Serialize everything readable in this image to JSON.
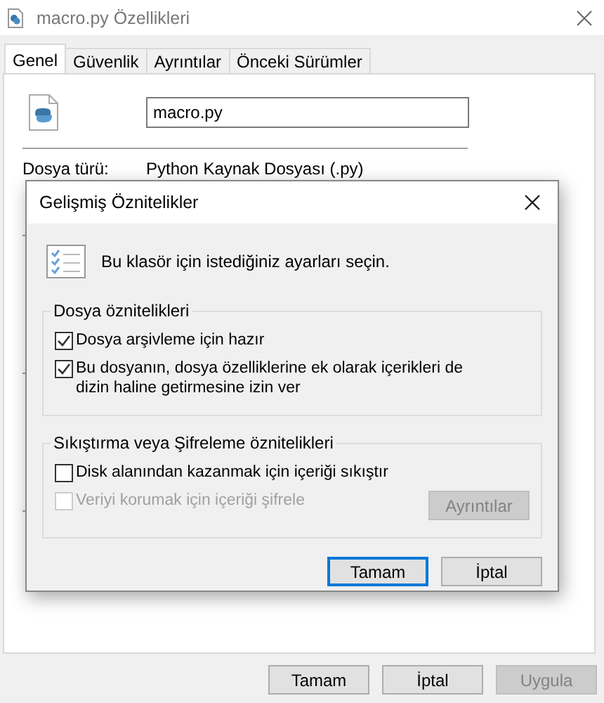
{
  "window": {
    "title": "macro.py Özellikleri"
  },
  "tabs": [
    {
      "label": "Genel",
      "selected": true
    },
    {
      "label": "Güvenlik",
      "selected": false
    },
    {
      "label": "Ayrıntılar",
      "selected": false
    },
    {
      "label": "Önceki Sürümler",
      "selected": false
    }
  ],
  "general": {
    "file_name": "macro.py",
    "type_label": "Dosya türü:",
    "type_value": "Python Kaynak Dosyası (.py)"
  },
  "dialog": {
    "title": "Gelişmiş Öznitelikler",
    "intro": "Bu klasör için istediğiniz ayarları seçin.",
    "groups": [
      {
        "title": "Dosya öznitelikleri",
        "options": [
          {
            "label": "Dosya arşivleme için hazır",
            "checked": true,
            "disabled": false
          },
          {
            "label": "Bu dosyanın, dosya özelliklerine ek olarak içerikleri de dizin haline getirmesine izin ver",
            "checked": true,
            "disabled": false
          }
        ]
      },
      {
        "title": "Sıkıştırma veya Şifreleme öznitelikleri",
        "options": [
          {
            "label": "Disk alanından kazanmak için içeriği sıkıştır",
            "checked": false,
            "disabled": false
          },
          {
            "label": "Veriyi korumak için içeriği şifrele",
            "checked": false,
            "disabled": true,
            "button": {
              "label": "Ayrıntılar",
              "disabled": true
            }
          }
        ]
      }
    ],
    "buttons": [
      {
        "label": "Tamam",
        "default": true
      },
      {
        "label": "İptal",
        "default": false
      }
    ]
  },
  "buttons": [
    {
      "label": "Tamam",
      "disabled": false
    },
    {
      "label": "İptal",
      "disabled": false
    },
    {
      "label": "Uygula",
      "disabled": true
    }
  ]
}
